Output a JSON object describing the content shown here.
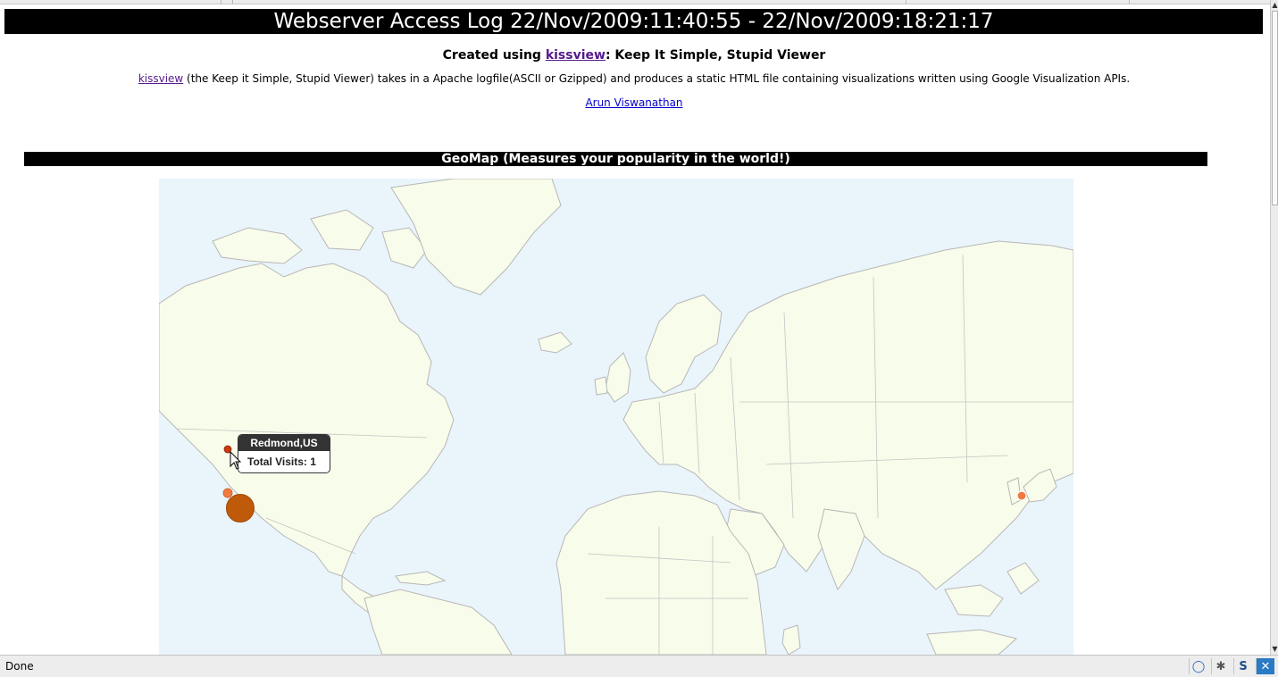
{
  "page": {
    "header_title": "Webserver Access Log 22/Nov/2009:11:40:55 - 22/Nov/2009:18:21:17",
    "created_prefix": "Created using ",
    "created_link": "kissview",
    "created_suffix": ": Keep It Simple, Stupid Viewer",
    "desc_link": "kissview",
    "desc_text": " (the Keep it Simple, Stupid Viewer) takes in a Apache logfile(ASCII or Gzipped) and produces a static HTML file containing visualizations written using Google Visualization APIs.",
    "author_link": "Arun Viswanathan"
  },
  "geomap": {
    "section_title": "GeoMap (Measures your popularity in the world!)",
    "tooltip": {
      "title": "Redmond,US",
      "body": "Total Visits: 1"
    },
    "colors": {
      "ocean": "#eaf4fb",
      "land": "#f8fcea",
      "borders": "#b7b7b7",
      "marker_large": "#bf5a0a",
      "marker_small": "#f07a3f",
      "marker_hover": "#cc3a12"
    }
  },
  "statusbar": {
    "text": "Done",
    "icons": [
      "chat-icon",
      "bug-icon",
      "s-badge-icon",
      "x-extension-icon"
    ],
    "icon_glyphs": [
      "◯",
      "✱",
      "S",
      "✕"
    ]
  },
  "browser": {
    "scroll_up_glyph": "▲",
    "scroll_down_glyph": "▼"
  }
}
